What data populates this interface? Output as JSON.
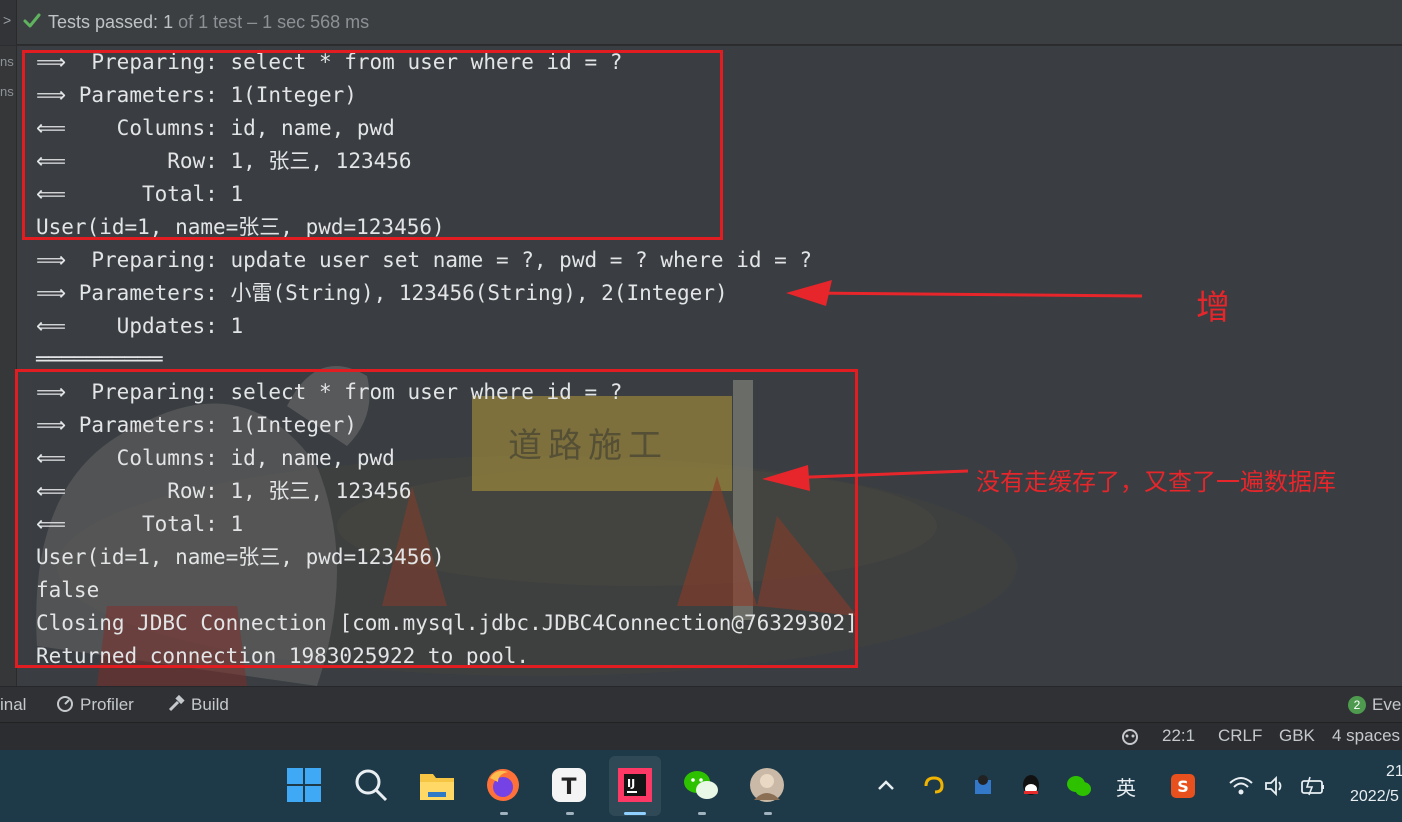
{
  "topbar": {
    "sidebar_char": ">",
    "status_prefix": "Tests passed: ",
    "status_count": "1",
    "status_suffix": " of 1 test – 1 sec 568 ms"
  },
  "gutter": {
    "items": [
      "ns",
      "ns"
    ]
  },
  "console": {
    "lines": [
      "⟹  Preparing: select * from user where id = ?",
      "⟹ Parameters: 1(Integer)",
      "⟸    Columns: id, name, pwd",
      "⟸        Row: 1, 张三, 123456",
      "⟸      Total: 1",
      "User(id=1, name=张三, pwd=123456)",
      "⟹  Preparing: update user set name = ?, pwd = ? where id = ?",
      "⟹ Parameters: 小雷(String), 123456(String), 2(Integer)",
      "⟸    Updates: 1",
      "══════════",
      "⟹  Preparing: select * from user where id = ?",
      "⟹ Parameters: 1(Integer)",
      "⟸    Columns: id, name, pwd",
      "⟸        Row: 1, 张三, 123456",
      "⟸      Total: 1",
      "User(id=1, name=张三, pwd=123456)",
      "false",
      "Closing JDBC Connection [com.mysql.jdbc.JDBC4Connection@76329302]",
      "Returned connection 1983025922 to pool."
    ],
    "background_sign": "道路施工"
  },
  "annotations": {
    "insert_label": "增",
    "cache_label": "没有走缓存了，又查了一遍数据库",
    "color": "#e6262b"
  },
  "toolwindows": {
    "terminal": "inal",
    "profiler": "Profiler",
    "build": "Build",
    "events_count": "2",
    "events": "Even"
  },
  "statusbar": {
    "position": "22:1",
    "line_sep": "CRLF",
    "encoding": "GBK",
    "indent": "4 spaces"
  },
  "taskbar": {
    "apps": [
      "windows-start-icon",
      "search-icon",
      "file-explorer-icon",
      "firefox-icon",
      "typora-icon",
      "intellij-icon",
      "wechat-icon",
      "avatar-app-icon"
    ],
    "ime": "英",
    "clock_time": "21",
    "clock_date": "2022/5"
  }
}
